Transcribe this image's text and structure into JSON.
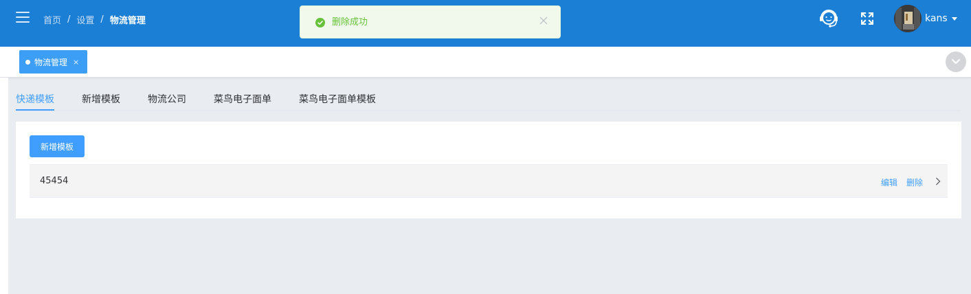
{
  "header": {
    "breadcrumb": [
      "首页",
      "设置",
      "物流管理"
    ],
    "separator": "/",
    "username": "kans",
    "brand_color": "#1c7fd6"
  },
  "toast": {
    "type": "success",
    "message": "删除成功"
  },
  "tags_bar": {
    "tags": [
      {
        "label": "物流管理",
        "close": "×",
        "active": true
      }
    ]
  },
  "tabs": [
    {
      "label": "快递模板",
      "active": true
    },
    {
      "label": "新增模板",
      "active": false
    },
    {
      "label": "物流公司",
      "active": false
    },
    {
      "label": "菜鸟电子面单",
      "active": false
    },
    {
      "label": "菜鸟电子面单模板",
      "active": false
    }
  ],
  "content": {
    "add_button_label": "新增模板",
    "templates": [
      {
        "name": "45454",
        "edit_label": "编辑",
        "delete_label": "删除"
      }
    ]
  },
  "colors": {
    "primary": "#409eff",
    "success": "#67c23a",
    "success_bg": "#f0f9eb"
  },
  "icons": [
    "menu-icon",
    "check-circle-icon",
    "close-icon",
    "headset-icon",
    "fullscreen-icon",
    "caret-down-icon",
    "chevron-down-icon",
    "chevron-right-icon"
  ]
}
